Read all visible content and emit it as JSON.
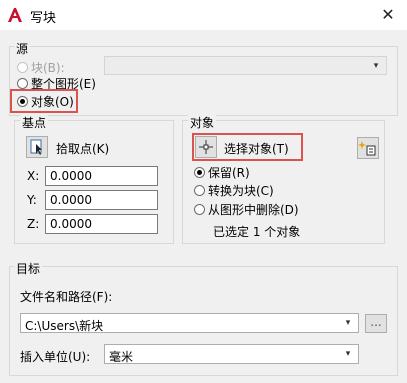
{
  "window": {
    "title": "写块"
  },
  "source": {
    "group_label": "源",
    "block_label": "块(B):",
    "entire_drawing_label": "整个图形(E)",
    "objects_label": "对象(O)",
    "selected": "objects"
  },
  "base_point": {
    "group_label": "基点",
    "pick_label": "拾取点(K)",
    "x_label": "X:",
    "y_label": "Y:",
    "z_label": "Z:",
    "x_value": "0.0000",
    "y_value": "0.0000",
    "z_value": "0.0000"
  },
  "objects": {
    "group_label": "对象",
    "select_label": "选择对象(T)",
    "retain_label": "保留(R)",
    "convert_label": "转换为块(C)",
    "delete_label": "从图形中删除(D)",
    "selected_option": "retain",
    "status_text": "已选定 1 个对象"
  },
  "destination": {
    "group_label": "目标",
    "path_label": "文件名和路径(F):",
    "path_value": "C:\\Users\\新块",
    "browse_label": "...",
    "units_label": "插入单位(U):",
    "units_value": "毫米"
  },
  "colors": {
    "highlight": "#d9534f",
    "logo": "#c8102e"
  }
}
